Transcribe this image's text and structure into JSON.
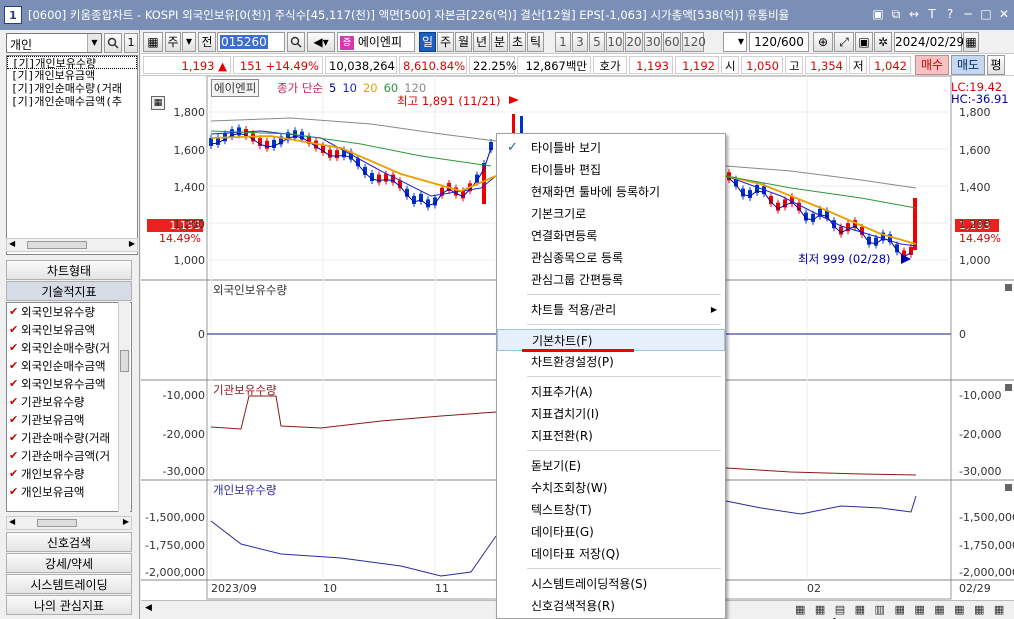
{
  "window": {
    "index": "1",
    "title": "[0600] 키움종합차트 - KOSPI 외국인보유[0(천)] 주식수[45,117(천)] 액면[500] 자본금[226(억)] 결산[12월] EPS[-1,063] 시가총액[538(억)] 유통비율",
    "buttons": [
      "▣",
      "⧉",
      "↔",
      "T",
      "?",
      "─",
      "□",
      "✕"
    ]
  },
  "left_panel": {
    "combo_value": "개인",
    "search_button": "🔍",
    "num_button": "1",
    "investor_list": [
      "[기]개인보유수량",
      "[기]개인보유금액",
      "[기]개인순매수량(거래",
      "[기]개인순매수금액(추"
    ],
    "sections": [
      "차트형태",
      "기술적지표"
    ],
    "indicators": [
      "외국인보유수량",
      "외국인보유금액",
      "외국인순매수량(거",
      "외국인순매수금액",
      "외국인보유수금액",
      "기관보유수량",
      "기관보유금액",
      "기관순매수량(거래",
      "기관순매수금액(거",
      "개인보유수량",
      "개인보유금액"
    ],
    "bottom_sections": [
      "신호검색",
      "강세/약세",
      "시스템트레이딩",
      "나의 관심지표"
    ]
  },
  "toolbar": {
    "code": "015260",
    "stock_name": "에이엔피",
    "tabs": [
      "일",
      "주",
      "월",
      "년",
      "분",
      "초",
      "틱"
    ],
    "active_tab": "일",
    "periods": [
      "1",
      "3",
      "5",
      "10",
      "20",
      "30",
      "60",
      "120"
    ],
    "count": "120/600",
    "date": "2024/02/29",
    "type_labels": [
      "주",
      "전"
    ]
  },
  "quote_bar": {
    "price": "1,193",
    "change": "151",
    "change_pct": "+14.49%",
    "volume": "10,038,264",
    "vol_ratio": "8,610.84%",
    "turnover": "22.25%",
    "amount": "12,867백만",
    "bid_label": "호가",
    "ask": "1,193",
    "bid": "1,192",
    "open_label": "시",
    "open": "1,050",
    "high_label": "고",
    "high": "1,354",
    "low_label": "저",
    "low": "1,042",
    "buy_btn": "매수",
    "sell_btn": "매도",
    "eval_btn": "평"
  },
  "chart": {
    "stock_label": "에이엔피",
    "ma_legend": [
      "종가 단순",
      "5",
      "10",
      "20",
      "60",
      "120"
    ],
    "ma_colors": [
      "#cc2255",
      "#0000aa",
      "#2222cc",
      "#e8a000",
      "#2a9a3a",
      "#888888"
    ],
    "high_note": "최고 1,891 (11/21)",
    "low_note": "최저 999 (02/28)",
    "lc": "LC:19.42",
    "hc": "HC:-36.91",
    "price_box": "1,193",
    "pct_box": "14.49%",
    "price_ticks": [
      "1,800",
      "1,600",
      "1,400",
      "1,200",
      "1,000"
    ],
    "pane2_title": "외국인보유수량",
    "pane2_ticks": [
      "0"
    ],
    "pane3_title": "기관보유수량",
    "pane3_ticks": [
      "-10,000",
      "-20,000",
      "-30,000"
    ],
    "pane4_title": "개인보유수량",
    "pane4_ticks": [
      "-1,500,000",
      "-1,750,000",
      "-2,000,000"
    ],
    "date_ticks": [
      "2023/09",
      "10",
      "11",
      "02",
      "02/29"
    ]
  },
  "context_menu": {
    "groups": [
      [
        {
          "label": "타이틀바 보기",
          "checked": true
        },
        {
          "label": "타이틀바 편집"
        },
        {
          "label": "현재화면 툴바에 등록하기"
        },
        {
          "label": "기본크기로"
        },
        {
          "label": "연결화면등록"
        },
        {
          "label": "관심종목으로 등록"
        },
        {
          "label": "관심그룹 간편등록"
        }
      ],
      [
        {
          "label": "차트틀 적용/관리",
          "submenu": true
        }
      ],
      [
        {
          "label": "기본차트(F)",
          "highlighted": true
        },
        {
          "label": "차트환경설정(P)"
        }
      ],
      [
        {
          "label": "지표추가(A)"
        },
        {
          "label": "지표겹치기(I)"
        },
        {
          "label": "지표전환(R)"
        }
      ],
      [
        {
          "label": "돋보기(E)"
        },
        {
          "label": "수치조회창(W)"
        },
        {
          "label": "텍스트창(T)"
        },
        {
          "label": "데이타표(G)"
        },
        {
          "label": "데이타표 저장(Q)"
        }
      ],
      [
        {
          "label": "시스템트레이딩적용(S)"
        },
        {
          "label": "신호검색적용(R)"
        }
      ]
    ]
  }
}
